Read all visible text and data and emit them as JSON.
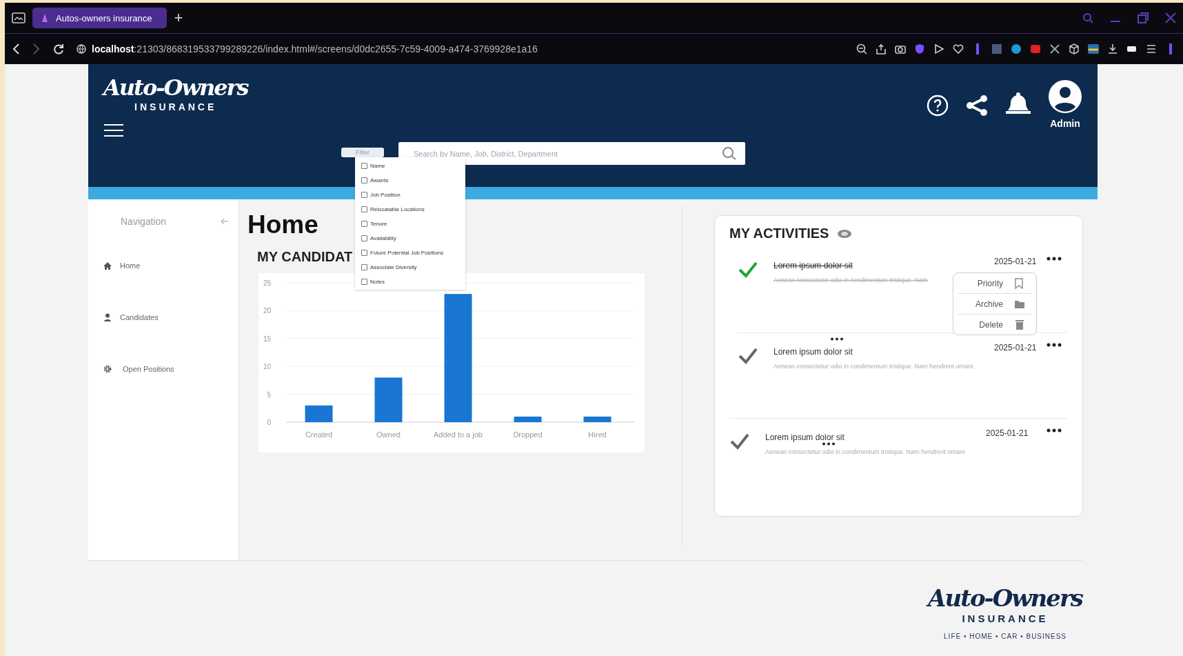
{
  "browser": {
    "tab_title": "Autos-owners insurance",
    "new_tab": "+",
    "url_host": "localhost",
    "url_path": ":21303/868319533799289226/index.html#/screens/d0dc2655-7c59-4009-a474-3769928e1a16"
  },
  "header": {
    "logo_wordmark": "Auto-Owners",
    "logo_subtitle": "INSURANCE",
    "filter_button": "Filter",
    "search": {
      "placeholder": "Search by Name, Job, District, Department"
    },
    "user": "Admin"
  },
  "filter_menu": [
    {
      "label": "Name",
      "checked": false
    },
    {
      "label": "Awards",
      "checked": false
    },
    {
      "label": "Job Position",
      "checked": false
    },
    {
      "label": "Relocatable Locations",
      "checked": false
    },
    {
      "label": "Tenure",
      "checked": false
    },
    {
      "label": "Availability",
      "checked": false
    },
    {
      "label": "Future Potential Job Positions",
      "checked": false
    },
    {
      "label": "Associate Diversity",
      "checked": false
    },
    {
      "label": "Notes",
      "checked": false
    }
  ],
  "sidebar": {
    "title": "Navigation",
    "items": [
      {
        "label": "Home",
        "kind": "home"
      },
      {
        "label": "Candidates",
        "kind": "person"
      },
      {
        "label": "Open Positions",
        "kind": "gear"
      }
    ]
  },
  "page_title": "Home",
  "candidates": {
    "title": "MY CANDIDAT",
    "chart_data": {
      "type": "bar",
      "categories": [
        "Created",
        "Owned",
        "Added to a job",
        "Dropped",
        "Hired"
      ],
      "values": [
        3,
        8,
        23,
        1,
        1
      ],
      "ylim": [
        0,
        25
      ],
      "grid": true,
      "yticks": [
        0,
        5,
        10,
        15,
        20,
        25
      ]
    }
  },
  "activities": {
    "title": "MY ACTIVITIES",
    "items": [
      {
        "title": "Lorem ipsum dolor sit",
        "description": "Aenean consectetur odio in condimentum tristique. Nam",
        "date": "2025-01-21",
        "done": true
      },
      {
        "title": "Lorem ipsum dolor sit",
        "description": "Aenean consectetur odio in condimentum tristique. Nam hendrerit ornare",
        "date": "2025-01-21",
        "done": false
      },
      {
        "title": "Lorem ipsum dolor sit",
        "description": "Aenean consectetur odio in condimentum tristique. Nam hendrerit ornare",
        "date": "2025-01-21",
        "done": false
      }
    ],
    "menu": [
      {
        "label": "Priority",
        "kind": "bookmark"
      },
      {
        "label": "Archive",
        "kind": "folder"
      },
      {
        "label": "Delete",
        "kind": "trash"
      }
    ]
  },
  "footer": {
    "logo_wordmark": "Auto-Owners",
    "logo_subtitle": "INSURANCE",
    "tagline": "LIFE • HOME • CAR • BUSINESS"
  }
}
